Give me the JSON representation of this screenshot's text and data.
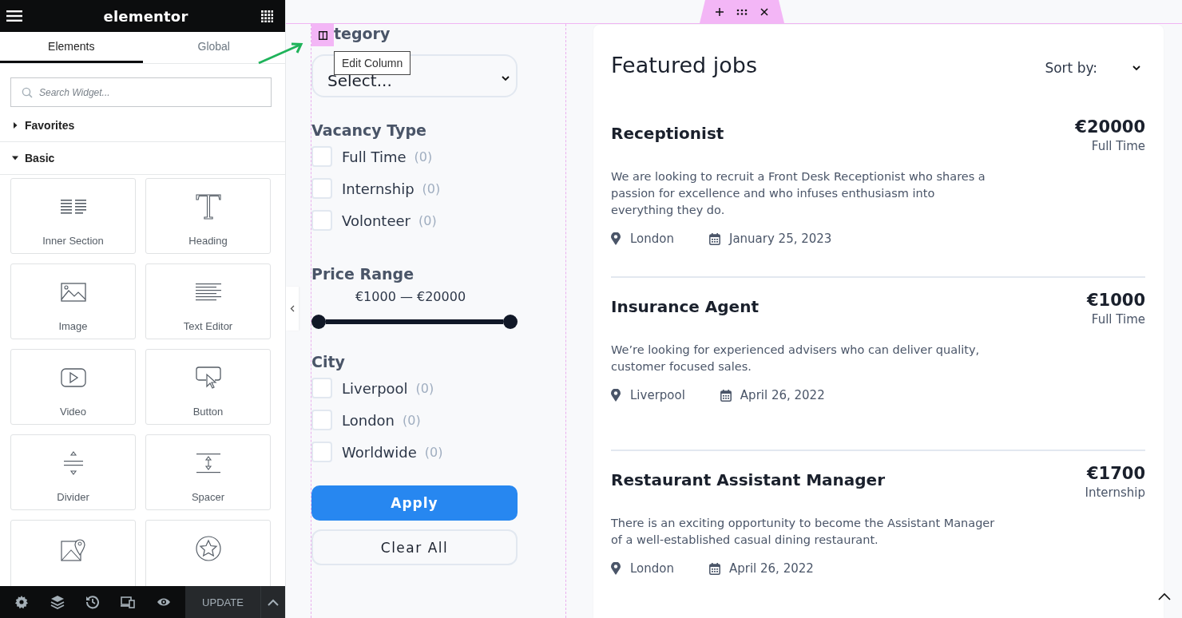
{
  "editor": {
    "logo": "elementor",
    "tabs": [
      {
        "label": "Elements",
        "selected": true
      },
      {
        "label": "Global",
        "selected": false
      }
    ],
    "search": {
      "placeholder": "Search Widget..."
    },
    "categories": [
      {
        "label": "Favorites",
        "expanded": false
      },
      {
        "label": "Basic",
        "expanded": true
      }
    ],
    "widgets": [
      {
        "label": "Inner Section"
      },
      {
        "label": "Heading"
      },
      {
        "label": "Image"
      },
      {
        "label": "Text Editor"
      },
      {
        "label": "Video"
      },
      {
        "label": "Button"
      },
      {
        "label": "Divider"
      },
      {
        "label": "Spacer"
      }
    ],
    "footer": {
      "update_label": "UPDATE"
    }
  },
  "canvas": {
    "tooltip": "Edit Column",
    "filters": {
      "category": {
        "title": "tegory",
        "select": "Select..."
      },
      "vacancy_type": {
        "title": "Vacancy Type",
        "options": [
          {
            "label": "Full Time",
            "count": "(0)",
            "checked": false
          },
          {
            "label": "Internship",
            "count": "(0)",
            "checked": false
          },
          {
            "label": "Volonteer",
            "count": "(0)",
            "checked": false
          }
        ]
      },
      "price_range": {
        "title": "Price Range",
        "reading": "€1000 — €20000"
      },
      "city": {
        "title": "City",
        "options": [
          {
            "label": "Liverpool",
            "count": "(0)",
            "checked": false
          },
          {
            "label": "London",
            "count": "(0)",
            "checked": false
          },
          {
            "label": "Worldwide",
            "count": "(0)",
            "checked": false
          }
        ]
      },
      "apply_label": "Apply",
      "clear_label": "Clear All"
    },
    "jobs": {
      "title": "Featured jobs",
      "sort_label": "Sort by:",
      "items": [
        {
          "title": "Receptionist",
          "salary": "€20000",
          "type": "Full Time",
          "description": "We are looking to recruit a Front Desk Receptionist who shares a passion for excellence and who infuses enthusiasm into everything they do.",
          "location": "London",
          "date": "January 25, 2023"
        },
        {
          "title": "Insurance Agent",
          "salary": "€1000",
          "type": "Full Time",
          "description": "We’re looking for experienced advisers who can deliver quality, customer focused sales.",
          "location": "Liverpool",
          "date": "April 26, 2022"
        },
        {
          "title": "Restaurant Assistant Manager",
          "salary": "€1700",
          "type": "Internship",
          "description": "There is an exciting opportunity to become the Assistant Manager of a well-established casual dining restaurant.",
          "location": "London",
          "date": "April 26, 2022"
        }
      ]
    }
  }
}
